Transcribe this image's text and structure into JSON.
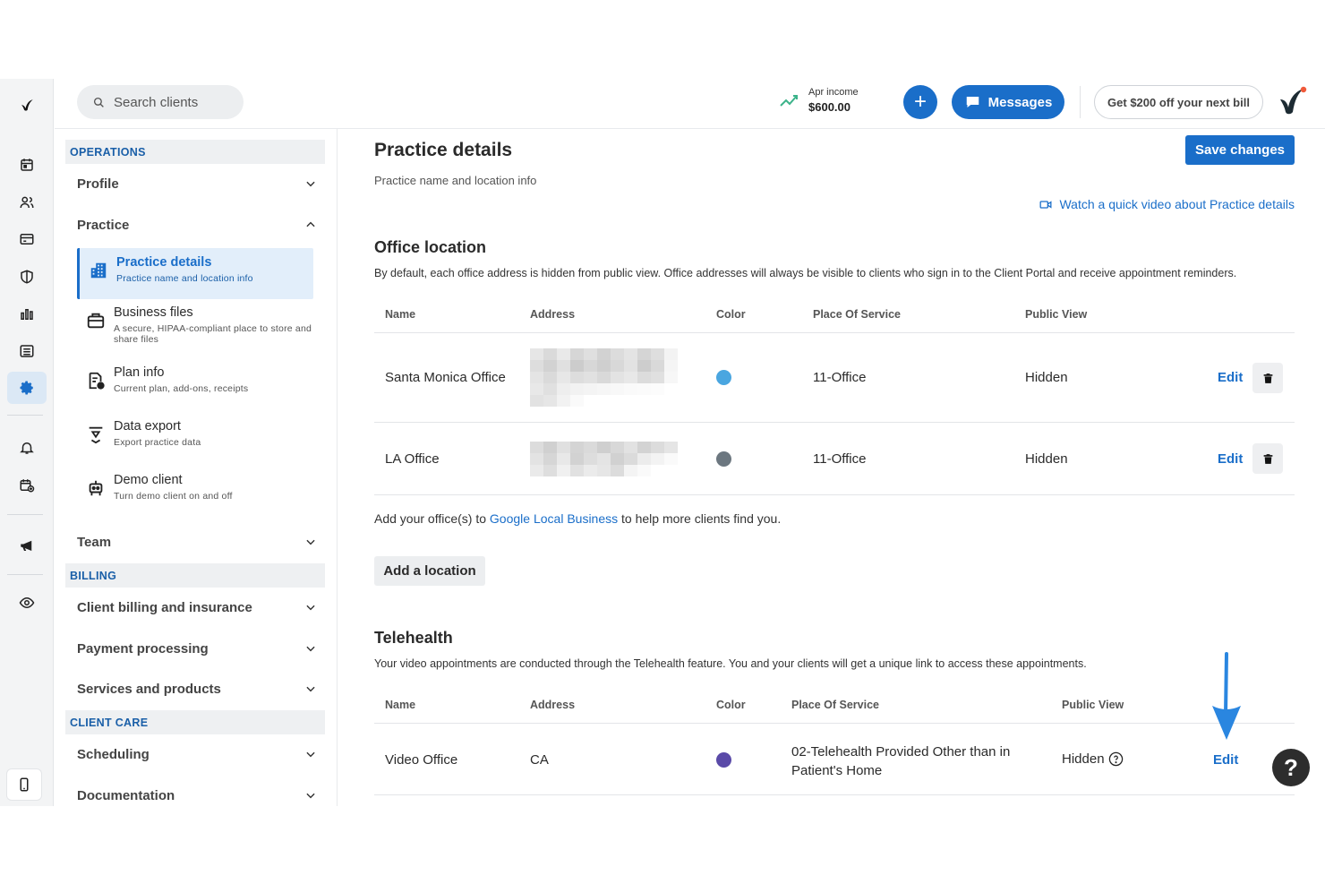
{
  "topbar": {
    "search_placeholder": "Search clients",
    "income_label": "Apr income",
    "income_value": "$600.00",
    "plus_label": "+",
    "messages_label": "Messages",
    "promo_label": "Get $200 off your next bill"
  },
  "rail_icons": [
    "logo-icon",
    "calendar-icon",
    "clients-icon",
    "billing-card-icon",
    "shield-icon",
    "reports-icon",
    "list-icon",
    "settings-icon",
    "bell-icon",
    "calendar-add-icon",
    "megaphone-icon",
    "eye-icon",
    "mobile-icon"
  ],
  "nav": {
    "operations": "OPERATIONS",
    "profile": "Profile",
    "practice": "Practice",
    "subs": [
      {
        "title": "Practice details",
        "desc": "Practice name and location info"
      },
      {
        "title": "Business files",
        "desc": "A secure, HIPAA-compliant place to store and share files"
      },
      {
        "title": "Plan info",
        "desc": "Current plan, add-ons, receipts"
      },
      {
        "title": "Data export",
        "desc": "Export practice data"
      },
      {
        "title": "Demo client",
        "desc": "Turn demo client on and off"
      }
    ],
    "team": "Team",
    "billing": "BILLING",
    "client_billing": "Client billing and insurance",
    "payment": "Payment processing",
    "services": "Services and products",
    "client_care": "CLIENT CARE",
    "scheduling": "Scheduling",
    "documentation": "Documentation"
  },
  "main": {
    "title": "Practice details",
    "subtitle": "Practice name and location info",
    "save_label": "Save changes",
    "video_link": "Watch a quick video about Practice details",
    "office": {
      "heading": "Office location",
      "description": "By default, each office address is hidden from public view. Office addresses will always be visible to clients who sign in to the Client Portal and receive appointment reminders.",
      "columns": [
        "Name",
        "Address",
        "Color",
        "Place Of Service",
        "Public View"
      ],
      "rows": [
        {
          "name": "Santa Monica Office",
          "color": "#4aa6e0",
          "pos": "11-Office",
          "view": "Hidden",
          "edit": "Edit"
        },
        {
          "name": "LA Office",
          "color": "#6c7780",
          "pos": "11-Office",
          "view": "Hidden",
          "edit": "Edit"
        }
      ],
      "local_prefix": "Add your office(s) to ",
      "local_link": "Google Local Business",
      "local_suffix": " to help more clients find you.",
      "add_label": "Add a location"
    },
    "telehealth": {
      "heading": "Telehealth",
      "description": "Your video appointments are conducted through the Telehealth feature. You and your clients will get a unique link to access these appointments.",
      "columns": [
        "Name",
        "Address",
        "Color",
        "Place Of Service",
        "Public View"
      ],
      "row": {
        "name": "Video Office",
        "address": "CA",
        "color": "#5a4aa8",
        "pos_line1": "02-Telehealth Provided Other than in",
        "pos_line2": "Patient's Home",
        "view": "Hidden",
        "edit": "Edit"
      }
    },
    "help_label": "?"
  },
  "colors": {
    "accent": "#1a6ec9",
    "accent_dark": "#1a5fa8",
    "arrow": "#2a86e0"
  }
}
